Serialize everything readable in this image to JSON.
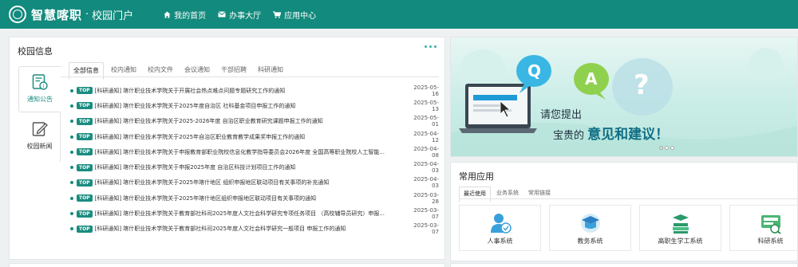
{
  "header": {
    "logo_title": "智慧喀职",
    "logo_separator": "·",
    "logo_subtitle": "校园门户",
    "nav": [
      {
        "label": "我的首页",
        "icon": "home-icon"
      },
      {
        "label": "办事大厅",
        "icon": "envelope-icon"
      },
      {
        "label": "应用中心",
        "icon": "cart-icon"
      }
    ]
  },
  "info_panel": {
    "title": "校园信息",
    "side_tabs": [
      {
        "label": "通知公告",
        "icon": "notice-icon",
        "active": true
      },
      {
        "label": "校园新闻",
        "icon": "edit-icon",
        "active": false
      }
    ],
    "category_tabs": [
      {
        "label": "全部信息",
        "active": true
      },
      {
        "label": "校内通知",
        "active": false
      },
      {
        "label": "校内文件",
        "active": false
      },
      {
        "label": "会议通知",
        "active": false
      },
      {
        "label": "干部招聘",
        "active": false
      },
      {
        "label": "科研通知",
        "active": false
      }
    ],
    "tag_label": "TOP",
    "news": [
      {
        "title": "[科研通知] 喀什职业技术学院关于开展社会热点难点问题专题研究工作的通知",
        "date": "2025-05-16"
      },
      {
        "title": "[科研通知] 喀什职业技术学院关于2025年度自治区 社科基金项目申报工作的通知",
        "date": "2025-05-13"
      },
      {
        "title": "[科研通知] 喀什职业技术学院关于2025-2026年度 自治区职业教育研究课题申报工作的通知",
        "date": "2025-05-01"
      },
      {
        "title": "[科研通知] 喀什职业技术学院关于2025年自治区职业教育教学成果奖申报工作的通知",
        "date": "2025-04-12"
      },
      {
        "title": "[科研通知] 喀什职业技术学院关于申报教育部职业院校信息化教学指导委员会2026年度 全国高等职业院校人工智能...",
        "date": "2025-04-08"
      },
      {
        "title": "[科研通知] 喀什职业技术学院关于申报2025年度 自治区科技计划项目工作的通知",
        "date": "2025-04-03"
      },
      {
        "title": "[科研通知] 喀什职业技术学院关于2025年喀什地区 组织申报地区联动项目有关事项的补充通知",
        "date": "2025-04-03"
      },
      {
        "title": "[科研通知] 喀什职业技术学院关于2025年喀什地区组织申报地区联动项目有关事项的通知",
        "date": "2025-03-28"
      },
      {
        "title": "[科研通知] 喀什职业技术学院关于教育部社科司2025年度人文社会科学研究专项任务项目 （高校辅导员研究）申报...",
        "date": "2025-03-07"
      },
      {
        "title": "[科研通知] 喀什职业技术学院关于教育部社科司2025年度人文社会科学研究一般项目 申报工作的通知",
        "date": "2025-03-07"
      }
    ]
  },
  "banner": {
    "line1": "请您提出",
    "line2_prefix": "宝贵的",
    "line2_emphasis": "意见和建议",
    "line2_suffix": "！",
    "bubble_q": "Q",
    "bubble_a": "A",
    "bubble_question": "?"
  },
  "apps_panel": {
    "title": "常用应用",
    "tabs": [
      {
        "label": "最近使用",
        "active": true
      },
      {
        "label": "业务系统",
        "active": false
      },
      {
        "label": "常用链接",
        "active": false
      }
    ],
    "apps": [
      {
        "label": "人事系统",
        "icon": "personnel-icon"
      },
      {
        "label": "教务系统",
        "icon": "academic-icon"
      },
      {
        "label": "高职生学工系统",
        "icon": "student-affairs-icon"
      },
      {
        "label": "科研系统",
        "icon": "research-icon"
      }
    ]
  },
  "colors": {
    "primary": "#128a7d",
    "accent": "#1a8c80"
  }
}
